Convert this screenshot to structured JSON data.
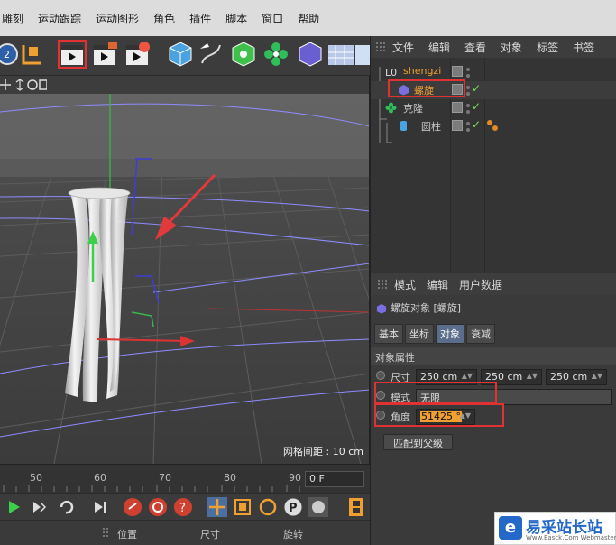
{
  "menubar": {
    "items": [
      "雕刻",
      "运动跟踪",
      "运动图形",
      "角色",
      "插件",
      "脚本",
      "窗口",
      "帮助"
    ]
  },
  "object_manager": {
    "menu": [
      "文件",
      "编辑",
      "查看",
      "对象",
      "标签",
      "书签"
    ],
    "objects": [
      {
        "name": "shengzi",
        "color": "#f0a030",
        "icon": "null-object-icon"
      },
      {
        "name": "螺旋",
        "color": "#f0a030",
        "icon": "helix-deformer-icon"
      },
      {
        "name": "克隆",
        "color": "#c8c8c8",
        "icon": "cloner-icon"
      },
      {
        "name": "圆柱",
        "color": "#c8c8c8",
        "icon": "cylinder-icon"
      }
    ]
  },
  "attributes": {
    "menu": [
      "模式",
      "编辑",
      "用户数据"
    ],
    "title": "螺旋对象 [螺旋]",
    "tabs": [
      "基本",
      "坐标",
      "对象",
      "衰减"
    ],
    "active_tab": "对象",
    "section": "对象属性",
    "size_label": "尺寸",
    "size": [
      "250 cm",
      "250 cm",
      "250 cm"
    ],
    "mode_label": "模式",
    "mode_value": "无限",
    "angle_label": "角度",
    "angle_value": "51425 °",
    "fit_parent_button": "匹配到父级"
  },
  "viewport": {
    "grid_spacing": "网格间距 : 10 cm"
  },
  "timeline": {
    "ticks": [
      "50",
      "60",
      "70",
      "80",
      "90"
    ],
    "current_frame": "0 F"
  },
  "coordinates": {
    "headers": [
      "位置",
      "尺寸",
      "旋转"
    ]
  },
  "watermark": {
    "brand": "易采站长站",
    "url": "Www.Easck.Com Webmaster",
    "logo_glyph": "e"
  },
  "colors": {
    "accent_orange": "#f0a030",
    "highlight_red": "#e03232",
    "check_green": "#76e05a",
    "active_tab": "#5a6d8a"
  }
}
